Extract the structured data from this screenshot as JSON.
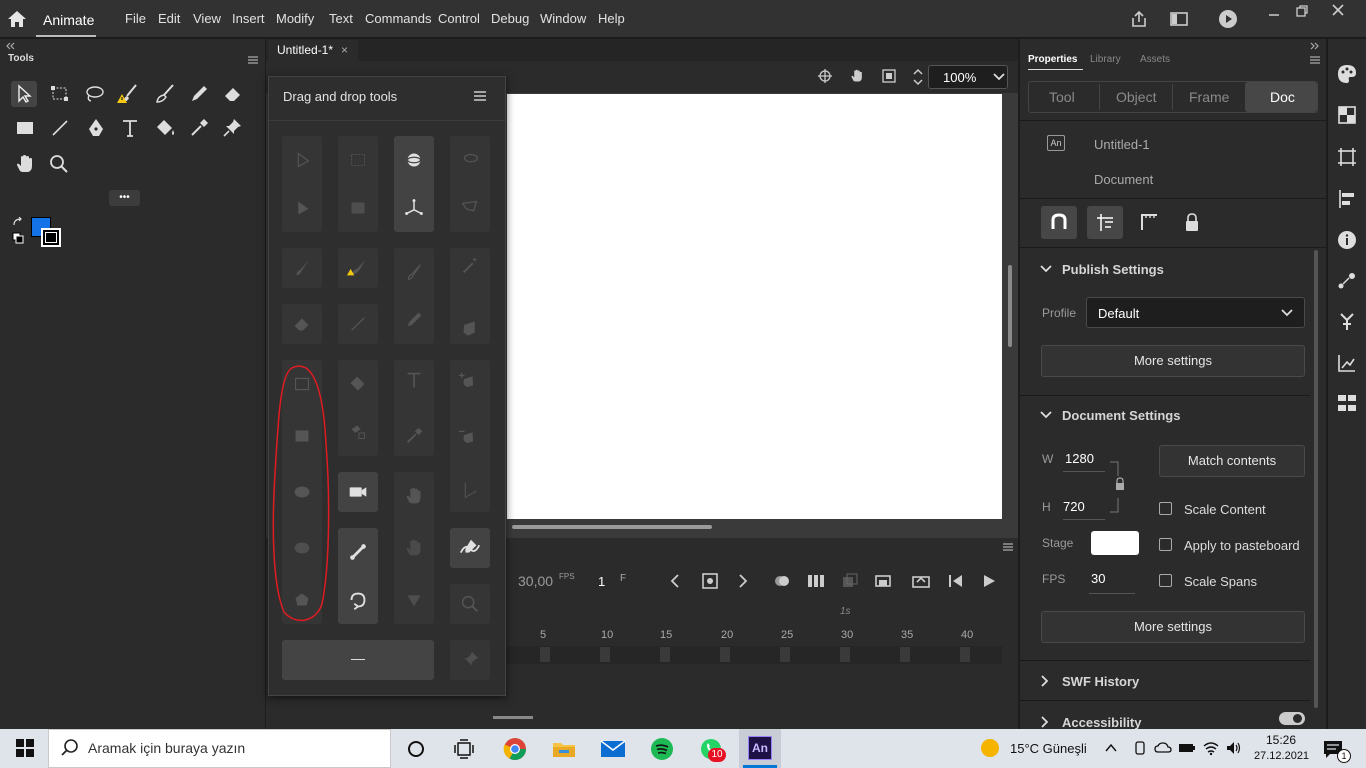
{
  "app": {
    "name": "Animate"
  },
  "menu": [
    "File",
    "Edit",
    "View",
    "Insert",
    "Modify",
    "Text",
    "Commands",
    "Control",
    "Debug",
    "Window",
    "Help"
  ],
  "tools_panel": {
    "title": "Tools",
    "more_label": "•••"
  },
  "document": {
    "tab_label": "Untitled-1*",
    "close_glyph": "×",
    "zoom": "100%"
  },
  "dnd_panel": {
    "title": "Drag and drop tools",
    "bottom_glyph": "—"
  },
  "timeline": {
    "fps": "30,00",
    "fps_unit": "FPS",
    "frame": "1",
    "frame_unit": "F",
    "second_marker": "1s",
    "ticks": [
      "5",
      "10",
      "15",
      "20",
      "25",
      "30",
      "35",
      "40"
    ]
  },
  "properties": {
    "tabs": [
      "Properties",
      "Library",
      "Assets"
    ],
    "segments": [
      "Tool",
      "Object",
      "Frame",
      "Doc"
    ],
    "doc_name": "Untitled-1",
    "doc_type": "Document",
    "doc_icon": "An",
    "publish": {
      "title": "Publish Settings",
      "profile_label": "Profile",
      "profile_value": "Default",
      "more": "More settings"
    },
    "doc_settings": {
      "title": "Document Settings",
      "w_label": "W",
      "w_value": "1280",
      "h_label": "H",
      "h_value": "720",
      "match": "Match contents",
      "scale_content": "Scale Content",
      "apply_pasteboard": "Apply to pasteboard",
      "stage_label": "Stage",
      "fps_label": "FPS",
      "fps_value": "30",
      "scale_spans": "Scale Spans",
      "more": "More settings"
    },
    "swf_history": "SWF History",
    "accessibility": "Accessibility"
  },
  "taskbar": {
    "search_placeholder": "Aramak için buraya yazın",
    "weather": "15°C  Güneşli",
    "time": "15:26",
    "date": "27.12.2021",
    "whatsapp_badge": "10",
    "animate_icon": "An",
    "notification_count": "1"
  },
  "colors": {
    "accent": "#1a7df0",
    "fill_color": "#1473e6",
    "stage": "#ffffff",
    "annotation": "#e11b22"
  }
}
